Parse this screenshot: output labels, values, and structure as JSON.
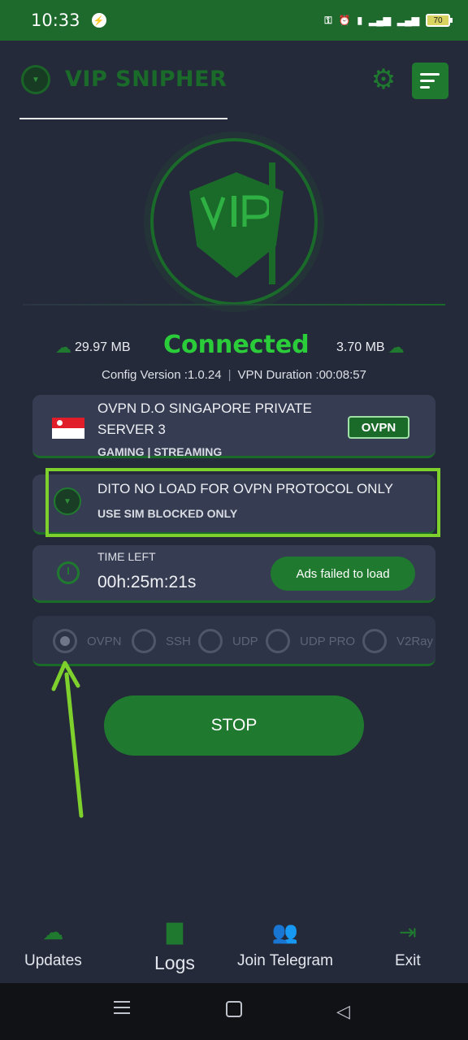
{
  "status_bar": {
    "time": "10:33",
    "battery": "70"
  },
  "header": {
    "brand": "VIP SNIPHER"
  },
  "stats": {
    "download": "29.97 MB",
    "upload": "3.70 MB",
    "status": "Connected"
  },
  "info": {
    "config_version": "Config Version :1.0.24",
    "separator": "|",
    "vpn_duration": "VPN Duration :00:08:57"
  },
  "server": {
    "name": "OVPN D.O SINGAPORE PRIVATE SERVER 3",
    "tags": "GAMING | STREAMING",
    "protocol_badge": "OVPN"
  },
  "payload": {
    "title": "DITO NO LOAD FOR OVPN PROTOCOL ONLY",
    "subtitle": "USE SIM BLOCKED ONLY"
  },
  "time_left": {
    "label": "TIME LEFT",
    "value": "00h:25m:21s",
    "ads_button": "Ads failed to load"
  },
  "protocols": [
    "OVPN",
    "SSH",
    "UDP",
    "UDP PRO",
    "V2Ray"
  ],
  "selected_protocol": "OVPN",
  "stop_button": "STOP",
  "bottom_nav": {
    "updates": "Updates",
    "logs": "Logs",
    "telegram": "Join Telegram",
    "exit": "Exit"
  },
  "colors": {
    "accent_green": "#1f7a2f",
    "status_green": "#2bcc3a",
    "highlight_green": "#7ed12c",
    "background": "#252a3b"
  }
}
